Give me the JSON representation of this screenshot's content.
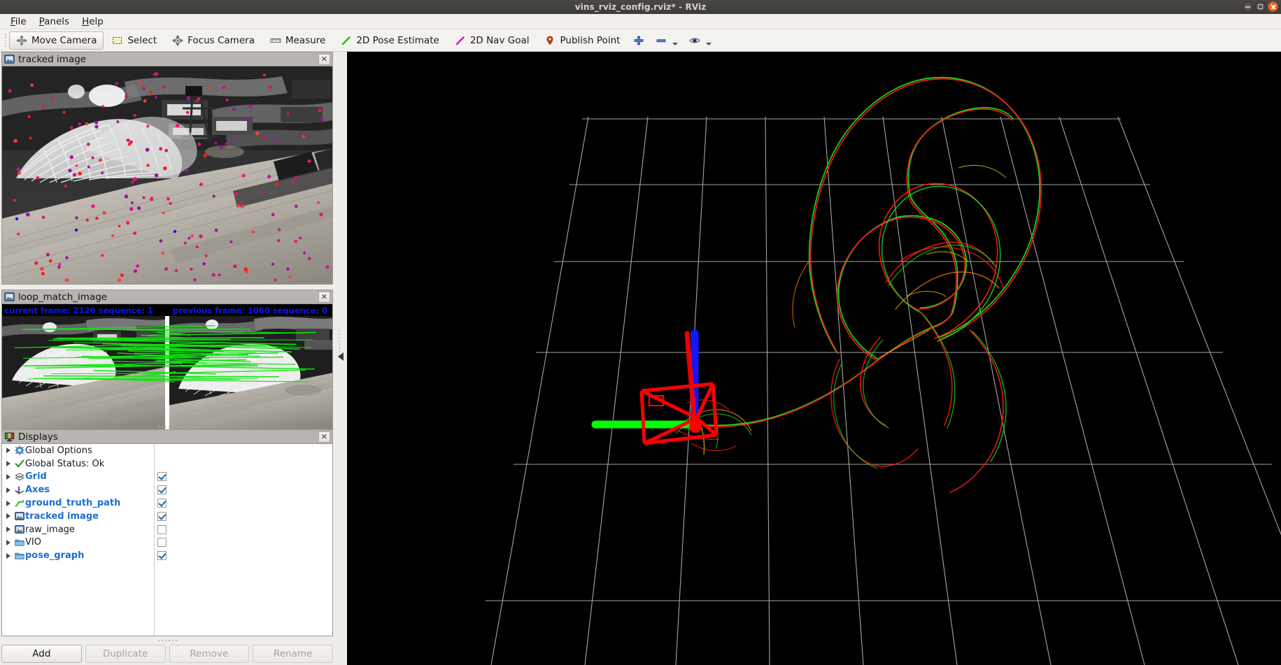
{
  "window": {
    "title": "vins_rviz_config.rviz* - RViz",
    "controls": [
      {
        "name": "minimize",
        "label": "–"
      },
      {
        "name": "maximize",
        "label": "□"
      },
      {
        "name": "close",
        "label": "✕"
      }
    ]
  },
  "menubar": {
    "items": [
      {
        "label": "File",
        "mnemonic": "F"
      },
      {
        "label": "Panels",
        "mnemonic": "P"
      },
      {
        "label": "Help",
        "mnemonic": "H"
      }
    ]
  },
  "toolbar": {
    "tools": [
      {
        "label": "Move Camera",
        "icon": "move-camera-icon",
        "active": true
      },
      {
        "label": "Select",
        "icon": "select-icon",
        "active": false
      },
      {
        "label": "Focus Camera",
        "icon": "focus-camera-icon",
        "active": false
      },
      {
        "label": "Measure",
        "icon": "measure-icon",
        "active": false
      },
      {
        "label": "2D Pose Estimate",
        "icon": "pose-estimate-icon",
        "active": false
      },
      {
        "label": "2D Nav Goal",
        "icon": "nav-goal-icon",
        "active": false
      },
      {
        "label": "Publish Point",
        "icon": "publish-point-icon",
        "active": false
      }
    ],
    "extra_tools": [
      {
        "label": "",
        "icon": "plus-icon",
        "has_dropdown": false
      },
      {
        "label": "",
        "icon": "minus-icon",
        "has_dropdown": true
      },
      {
        "label": "",
        "icon": "eye-icon",
        "has_dropdown": true
      }
    ]
  },
  "panels": {
    "tracked_image": {
      "title": "tracked image",
      "close_label": "✕",
      "icon": "image-display-icon"
    },
    "loop_match_image": {
      "title": "loop_match_image",
      "close_label": "✕",
      "icon": "image-display-icon",
      "overlay_left": "current frame: 2126   sequence: 1",
      "overlay_right": "previous frame: 1060   sequence: 0",
      "current_frame": 2126,
      "current_sequence": 1,
      "previous_frame": 1060,
      "previous_sequence": 0,
      "overlay_color": "#0b16f0"
    },
    "displays": {
      "title": "Displays",
      "close_label": "✕",
      "icon": "displays-panel-icon",
      "items": [
        {
          "label": "Global Options",
          "icon": "gear-icon",
          "highlighted": false,
          "checkbox": null
        },
        {
          "label": "Global Status: Ok",
          "icon": "check-status-icon",
          "highlighted": false,
          "checkbox": null
        },
        {
          "label": "Grid",
          "icon": "grid-icon",
          "highlighted": true,
          "checkbox": true
        },
        {
          "label": "Axes",
          "icon": "axes-icon",
          "highlighted": true,
          "checkbox": true
        },
        {
          "label": "ground_truth_path",
          "icon": "path-icon",
          "highlighted": true,
          "checkbox": true
        },
        {
          "label": "tracked image",
          "icon": "image-display-icon",
          "highlighted": true,
          "checkbox": true
        },
        {
          "label": "raw_image",
          "icon": "image-display-icon",
          "highlighted": false,
          "checkbox": false
        },
        {
          "label": "VIO",
          "icon": "folder-icon",
          "highlighted": false,
          "checkbox": false
        },
        {
          "label": "pose_graph",
          "icon": "folder-icon",
          "highlighted": true,
          "checkbox": true
        }
      ],
      "buttons": [
        {
          "label": "Add",
          "enabled": true
        },
        {
          "label": "Duplicate",
          "enabled": false
        },
        {
          "label": "Remove",
          "enabled": false
        },
        {
          "label": "Rename",
          "enabled": false
        }
      ]
    }
  },
  "view3d": {
    "background_color": "#000000",
    "grid_color": "#b4b4b4",
    "axes": [
      {
        "name": "x-axis",
        "color": "#00ff00"
      },
      {
        "name": "y-axis",
        "color": "#ff0000"
      },
      {
        "name": "z-axis",
        "color": "#1414ff"
      }
    ],
    "paths": [
      {
        "name": "vio_path",
        "color": "#ff0000"
      },
      {
        "name": "ground_truth_path",
        "color": "#00ff00"
      }
    ],
    "camera_marker_color": "#ff0000"
  },
  "splitter": {
    "collapse_label": "◀"
  }
}
